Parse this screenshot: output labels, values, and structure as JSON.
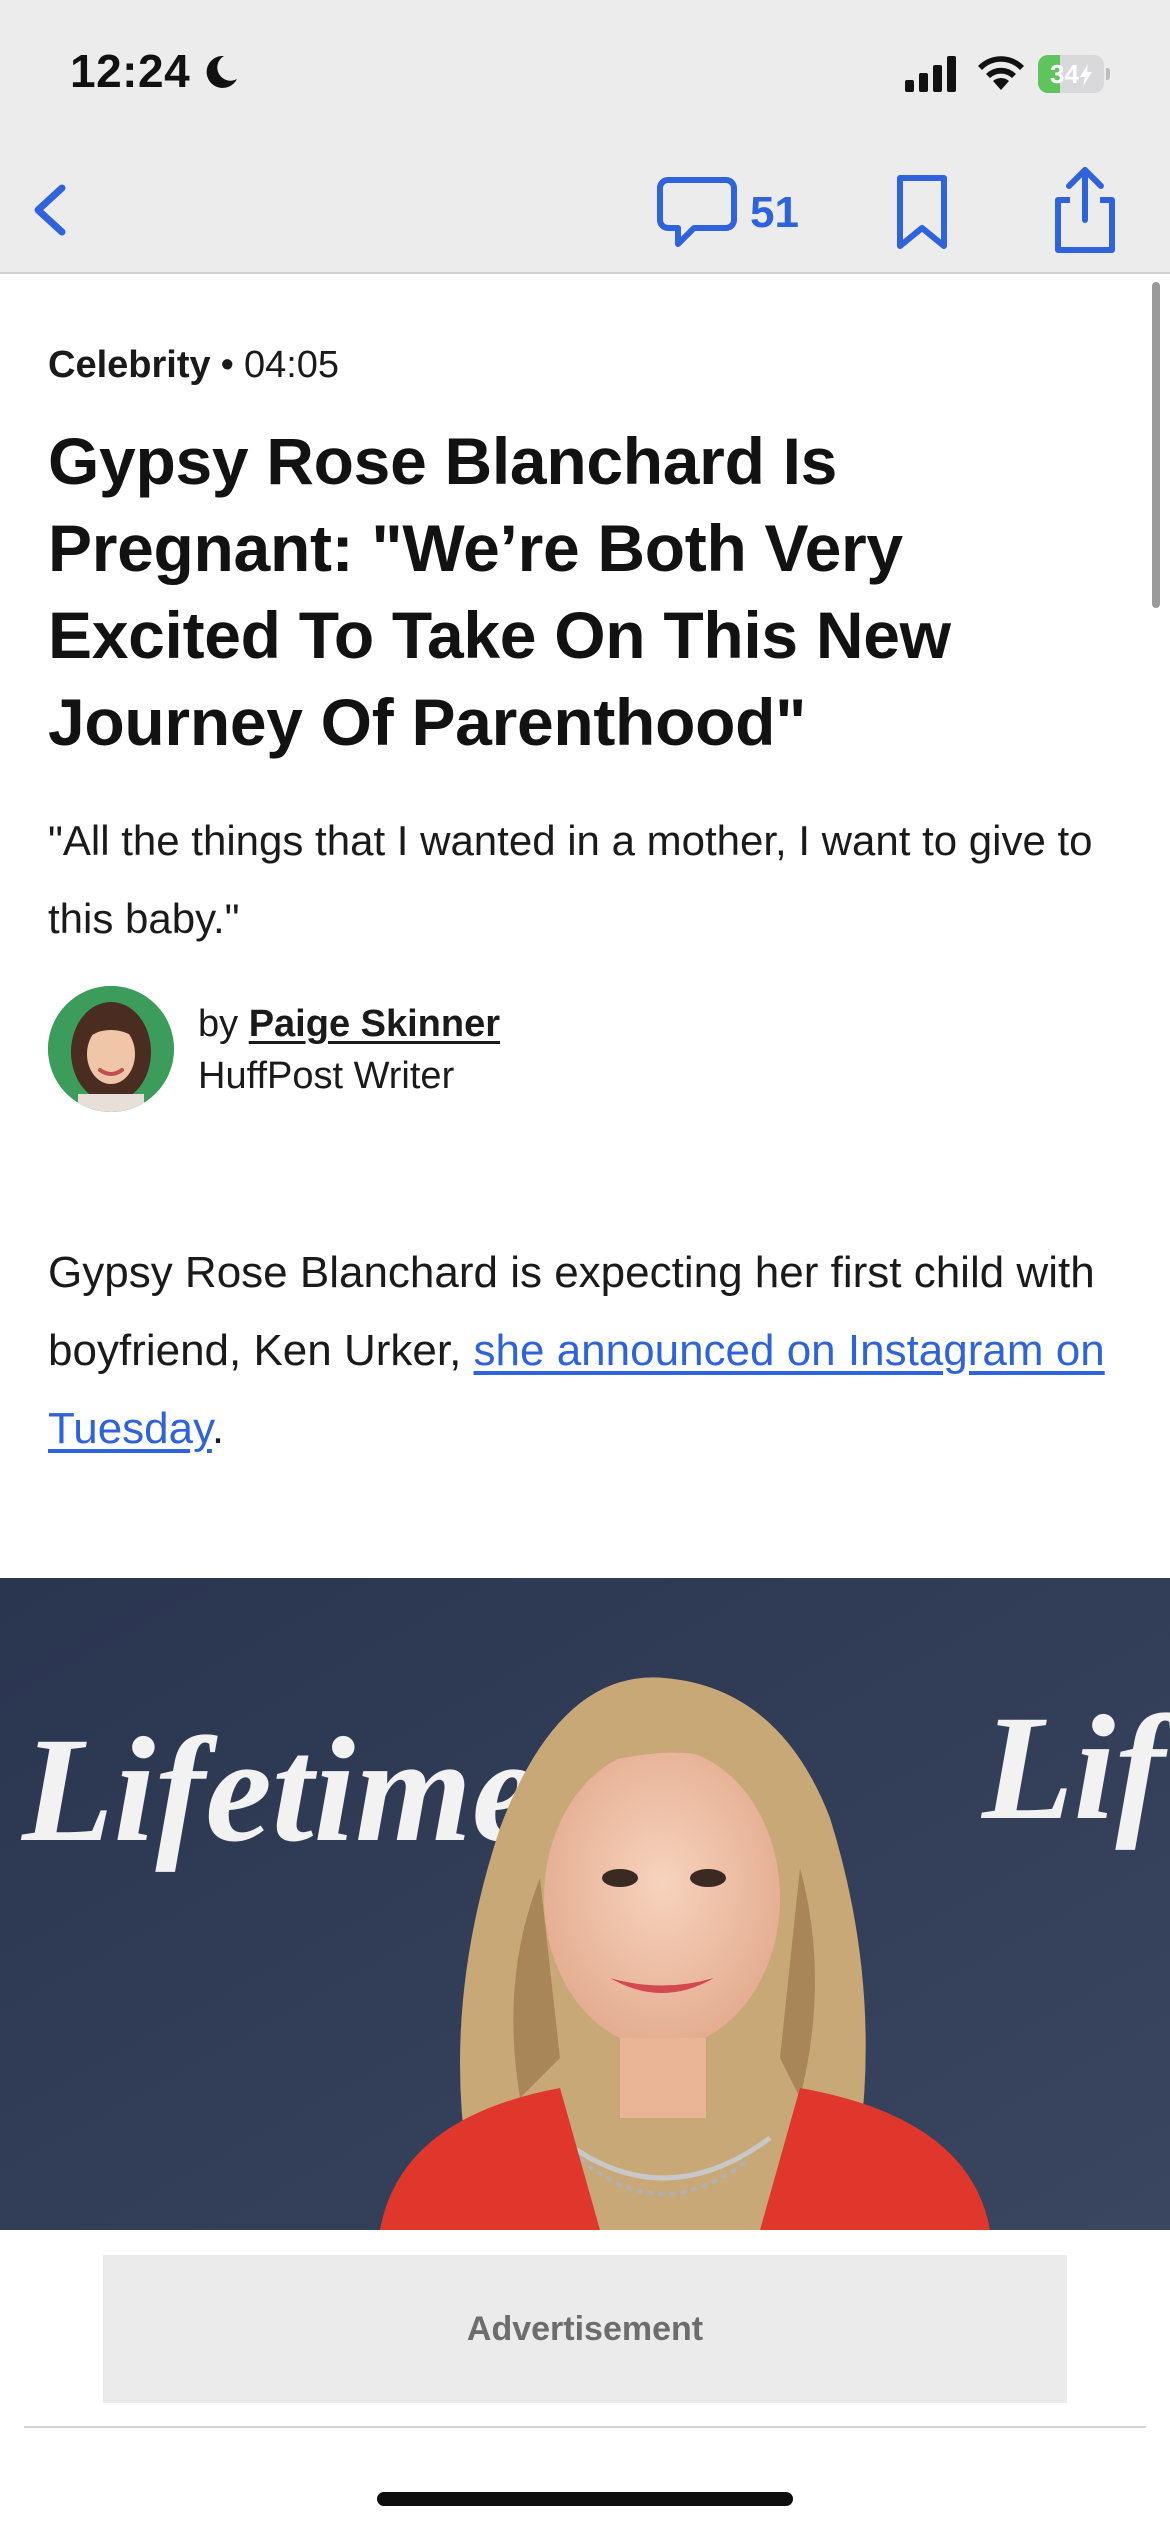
{
  "status_bar": {
    "time": "12:24",
    "battery_level": "34",
    "battery_percent": 34,
    "icons": [
      "moon-icon",
      "signal-icon",
      "wifi-icon",
      "battery-charging-icon"
    ]
  },
  "toolbar": {
    "comment_count": "51",
    "icons": [
      "back-chevron-icon",
      "comment-icon",
      "bookmark-icon",
      "share-icon"
    ],
    "accent_color": "#2f63dc"
  },
  "article": {
    "category": "Celebrity",
    "separator": "•",
    "time": "04:05",
    "headline": "Gypsy Rose Blanchard Is Pregnant: \"We’re Both Very Excited To Take On This New Journey Of Parenthood\"",
    "subhead": "\"All the things that I wanted in a mother, I want to give to this baby.\"",
    "byline": {
      "prefix": "by",
      "author": "Paige Skinner",
      "role": "HuffPost Writer"
    },
    "body": {
      "text_before": "Gypsy Rose Blanchard is expecting her first child with boyfriend, Ken Urker, ",
      "link_text": "she announced on Instagram on Tuesday",
      "text_after": "."
    },
    "photo": {
      "backdrop_text": "Lifetime",
      "backdrop_text_partial": "Lif"
    }
  },
  "ad": {
    "label": "Advertisement"
  }
}
